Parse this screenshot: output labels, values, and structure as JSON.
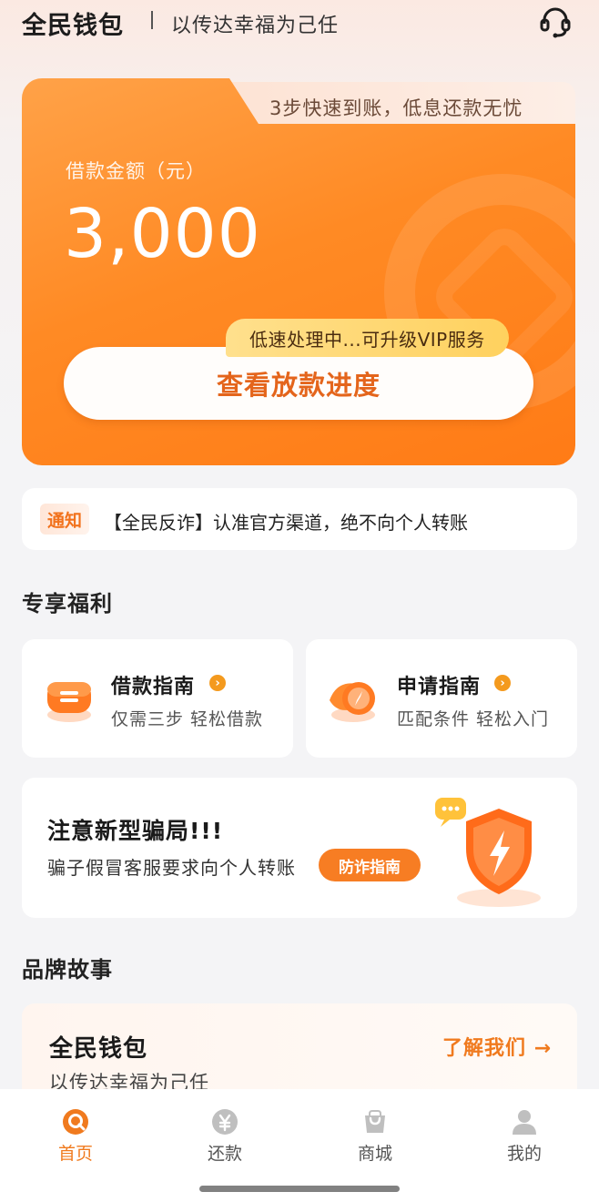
{
  "header": {
    "brand": "全民钱包",
    "slogan": "以传达幸福为己任",
    "support_icon": "headset-icon"
  },
  "loan_card": {
    "tab_text": "3步快速到账，低息还款无忧",
    "amount_label": "借款金额（元）",
    "amount_value": "3,000",
    "vip_badge": "低速处理中...可升级VIP服务",
    "cta_label": "查看放款进度"
  },
  "notice": {
    "tag": "通知",
    "text": "【全民反诈】认准官方渠道，绝不向个人转账"
  },
  "benefits": {
    "section_title": "专享福利",
    "items": [
      {
        "title": "借款指南",
        "subtitle": "仅需三步 轻松借款",
        "icon": "wallet-icon"
      },
      {
        "title": "申请指南",
        "subtitle": "匹配条件 轻松入门",
        "icon": "compass-icon"
      }
    ]
  },
  "scam_alert": {
    "title": "注意新型骗局!!!",
    "subtitle": "骗子假冒客服要求向个人转账",
    "button": "防诈指南",
    "icon": "shield-icon"
  },
  "brand_story": {
    "section_title": "品牌故事",
    "title": "全民钱包",
    "subtitle": "以传达幸福为己任",
    "link": "了解我们 →"
  },
  "tabbar": {
    "items": [
      {
        "label": "首页",
        "icon": "home-icon",
        "active": true
      },
      {
        "label": "还款",
        "icon": "yen-icon",
        "active": false
      },
      {
        "label": "商城",
        "icon": "shopping-bag-icon",
        "active": false
      },
      {
        "label": "我的",
        "icon": "user-icon",
        "active": false
      }
    ]
  },
  "colors": {
    "accent": "#ff8a24",
    "cta_text": "#e4651c",
    "vip_badge": "#ffd15e"
  }
}
